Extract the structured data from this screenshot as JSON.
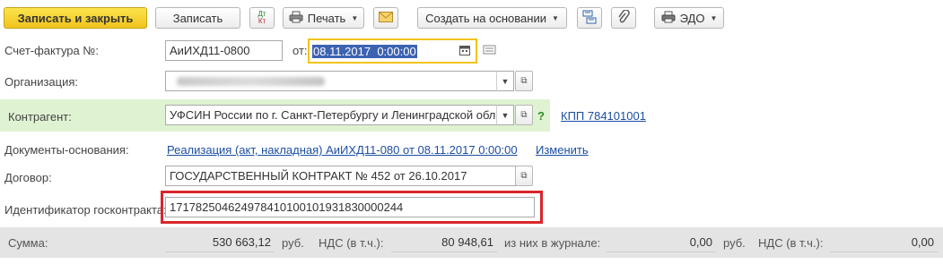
{
  "toolbar": {
    "save_close_label": "Записать и закрыть",
    "save_label": "Записать",
    "dtkt_top": "Дт",
    "dtkt_bottom": "Кт",
    "print_label": "Печать",
    "create_based_label": "Создать на основании",
    "edo_label": "ЭДО"
  },
  "invoice": {
    "label": "Счет-фактура №:",
    "number": "АиИХД11-0800",
    "date_label": "от:",
    "date": "08.11.2017  0:00:00"
  },
  "organization": {
    "label": "Организация:",
    "value": ""
  },
  "counterparty": {
    "label": "Контрагент:",
    "value": "УФСИН России по г. Санкт-Петербургу и Ленинградской обл",
    "help": "?",
    "kpp_link": "КПП 784101001"
  },
  "base_docs": {
    "label": "Документы-основания:",
    "link": "Реализация (акт, накладная) АиИХД11-080 от 08.11.2017 0:00:00",
    "change_link": "Изменить"
  },
  "contract": {
    "label": "Договор:",
    "value": "ГОСУДАРСТВЕННЫЙ КОНТРАКТ № 452 от 26.10.2017"
  },
  "gov_contract": {
    "label": "Идентификатор госконтракта:",
    "value": "1717825046249784101001019318300002​44"
  },
  "totals": {
    "sum_label": "Сумма:",
    "sum_value": "530 663,12",
    "currency1": "руб.",
    "vat_label": "НДС (в т.ч.):",
    "vat_value": "80 948,61",
    "journal_label": "из них в журнале:",
    "journal_value": "0,00",
    "currency2": "руб.",
    "vat_label2": "НДС (в т.ч.):",
    "vat_value2": "0,00"
  },
  "colors": {
    "accent_yellow": "#f1c31e",
    "counterparty_bg": "#dff2d2",
    "highlight_red": "#d9252b",
    "date_focus": "#f0c419",
    "link_blue": "#1c4ea3"
  }
}
